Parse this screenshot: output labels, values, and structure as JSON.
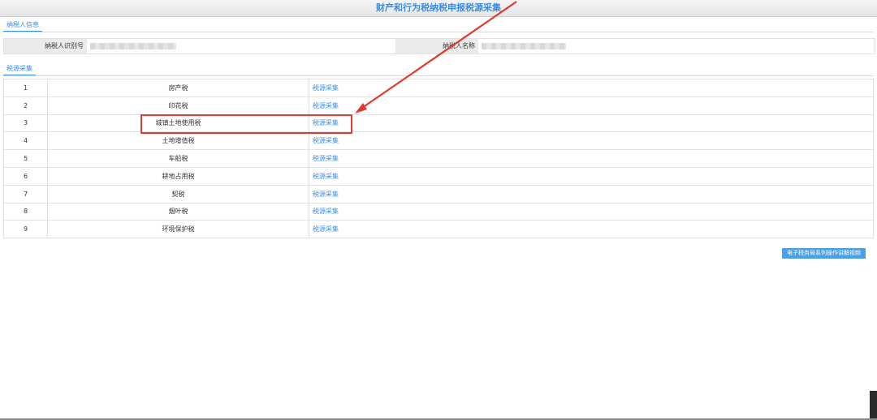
{
  "page": {
    "title": "财产和行为税纳税申报税源采集"
  },
  "taxpayer_section": {
    "tab_label": "纳税人信息",
    "id_label": "纳税人识别号",
    "name_label": "纳税人名称"
  },
  "source_section": {
    "tab_label": "税源采集"
  },
  "rows": [
    {
      "num": "1",
      "name": "房产税",
      "action": "税源采集"
    },
    {
      "num": "2",
      "name": "印花税",
      "action": "税源采集"
    },
    {
      "num": "3",
      "name": "城镇土地使用税",
      "action": "税源采集"
    },
    {
      "num": "4",
      "name": "土地增值税",
      "action": "税源采集"
    },
    {
      "num": "5",
      "name": "车船税",
      "action": "税源采集"
    },
    {
      "num": "6",
      "name": "耕地占用税",
      "action": "税源采集"
    },
    {
      "num": "7",
      "name": "契税",
      "action": "税源采集"
    },
    {
      "num": "8",
      "name": "烟叶税",
      "action": "税源采集"
    },
    {
      "num": "9",
      "name": "环境保护税",
      "action": "税源采集"
    }
  ],
  "video_button": {
    "label": "电子税务局系列操作讲解视频"
  },
  "colors": {
    "accent": "#3a8de0",
    "annotation": "#e23a2f"
  }
}
